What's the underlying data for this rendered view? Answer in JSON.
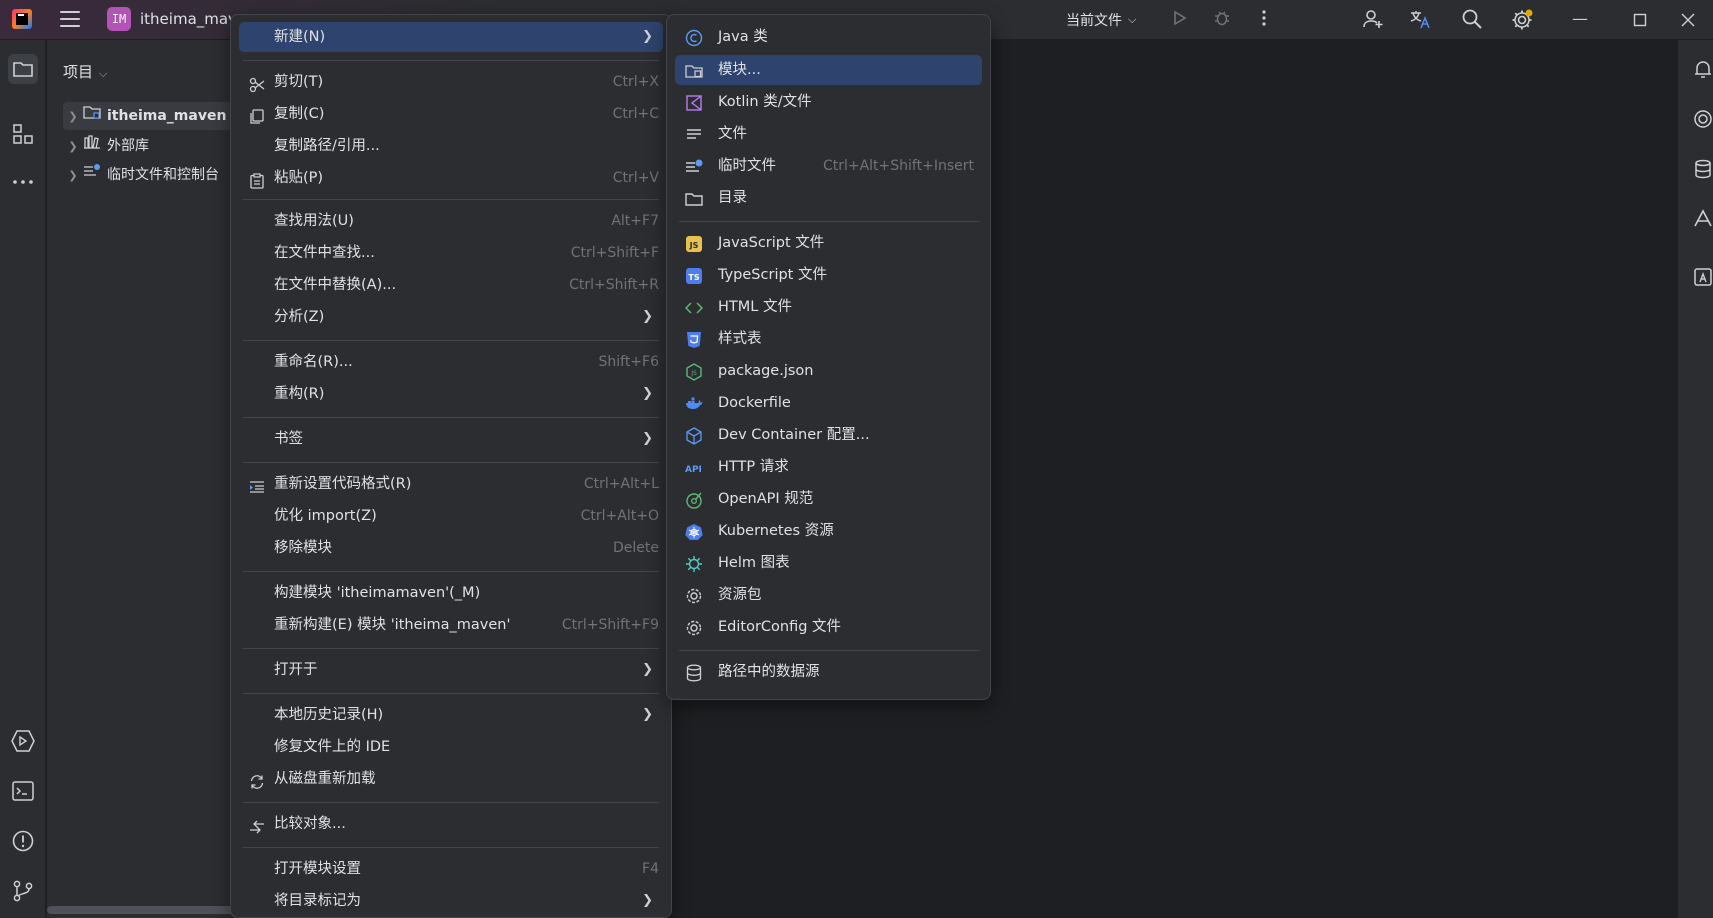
{
  "titlebar": {
    "project_badge": "IM",
    "project_name": "itheima_mav",
    "current_file": "当前文件"
  },
  "project_panel": {
    "title": "项目",
    "tree": [
      {
        "label": "itheima_maven",
        "icon": "module-folder-icon",
        "selected": true
      },
      {
        "label": "外部库",
        "icon": "library-icon"
      },
      {
        "label": "临时文件和控制台",
        "icon": "scratch-icon"
      }
    ]
  },
  "context_menu": {
    "items": [
      {
        "label": "新建(N)",
        "submenu": true,
        "highlighted": true
      },
      {
        "label": "剪切(T)",
        "shortcut": "Ctrl+X",
        "icon": "scissors-icon"
      },
      {
        "label": "复制(C)",
        "shortcut": "Ctrl+C",
        "icon": "copy-icon"
      },
      {
        "label": "复制路径/引用..."
      },
      {
        "label": "粘贴(P)",
        "shortcut": "Ctrl+V",
        "icon": "paste-icon"
      },
      {
        "label": "查找用法(U)",
        "shortcut": "Alt+F7"
      },
      {
        "label": "在文件中查找...",
        "shortcut": "Ctrl+Shift+F"
      },
      {
        "label": "在文件中替换(A)...",
        "shortcut": "Ctrl+Shift+R"
      },
      {
        "label": "分析(Z)",
        "submenu": true
      },
      {
        "label": "重命名(R)...",
        "shortcut": "Shift+F6"
      },
      {
        "label": "重构(R)",
        "submenu": true
      },
      {
        "label": "书签",
        "submenu": true
      },
      {
        "label": "重新设置代码格式(R)",
        "shortcut": "Ctrl+Alt+L",
        "icon": "reformat-icon"
      },
      {
        "label": "优化 import(Z)",
        "shortcut": "Ctrl+Alt+O"
      },
      {
        "label": "移除模块",
        "shortcut": "Delete"
      },
      {
        "label": "构建模块 'itheimamaven'(_M)"
      },
      {
        "label": "重新构建(E) 模块 'itheima_maven'",
        "shortcut": "Ctrl+Shift+F9"
      },
      {
        "label": "打开于",
        "submenu": true
      },
      {
        "label": "本地历史记录(H)",
        "submenu": true
      },
      {
        "label": "修复文件上的 IDE"
      },
      {
        "label": "从磁盘重新加载",
        "icon": "reload-icon"
      },
      {
        "label": "比较对象...",
        "icon": "compare-icon"
      },
      {
        "label": "打开模块设置",
        "shortcut": "F4"
      },
      {
        "label": "将目录标记为",
        "submenu": true
      }
    ]
  },
  "submenu_new": {
    "items": [
      {
        "label": "Java 类",
        "icon": "java-class-icon"
      },
      {
        "label": "模块...",
        "icon": "module-icon",
        "highlighted": true
      },
      {
        "label": "Kotlin 类/文件",
        "icon": "kotlin-icon"
      },
      {
        "label": "文件",
        "icon": "text-file-icon"
      },
      {
        "label": "临时文件",
        "shortcut": "Ctrl+Alt+Shift+Insert",
        "icon": "scratch-file-icon"
      },
      {
        "label": "目录",
        "icon": "folder-icon"
      },
      {
        "label": "JavaScript 文件",
        "icon": "javascript-icon"
      },
      {
        "label": "TypeScript 文件",
        "icon": "typescript-icon"
      },
      {
        "label": "HTML 文件",
        "icon": "html-icon"
      },
      {
        "label": "样式表",
        "icon": "css-icon"
      },
      {
        "label": "package.json",
        "icon": "nodejs-icon"
      },
      {
        "label": "Dockerfile",
        "icon": "docker-icon"
      },
      {
        "label": "Dev Container 配置...",
        "icon": "dev-container-icon"
      },
      {
        "label": "HTTP 请求",
        "icon": "api-icon"
      },
      {
        "label": "OpenAPI 规范",
        "icon": "openapi-icon"
      },
      {
        "label": "Kubernetes 资源",
        "icon": "kubernetes-icon"
      },
      {
        "label": "Helm 图表",
        "icon": "helm-icon"
      },
      {
        "label": "资源包",
        "icon": "resource-bundle-icon"
      },
      {
        "label": "EditorConfig 文件",
        "icon": "editorconfig-icon"
      },
      {
        "label": "路径中的数据源",
        "icon": "database-icon"
      }
    ]
  }
}
